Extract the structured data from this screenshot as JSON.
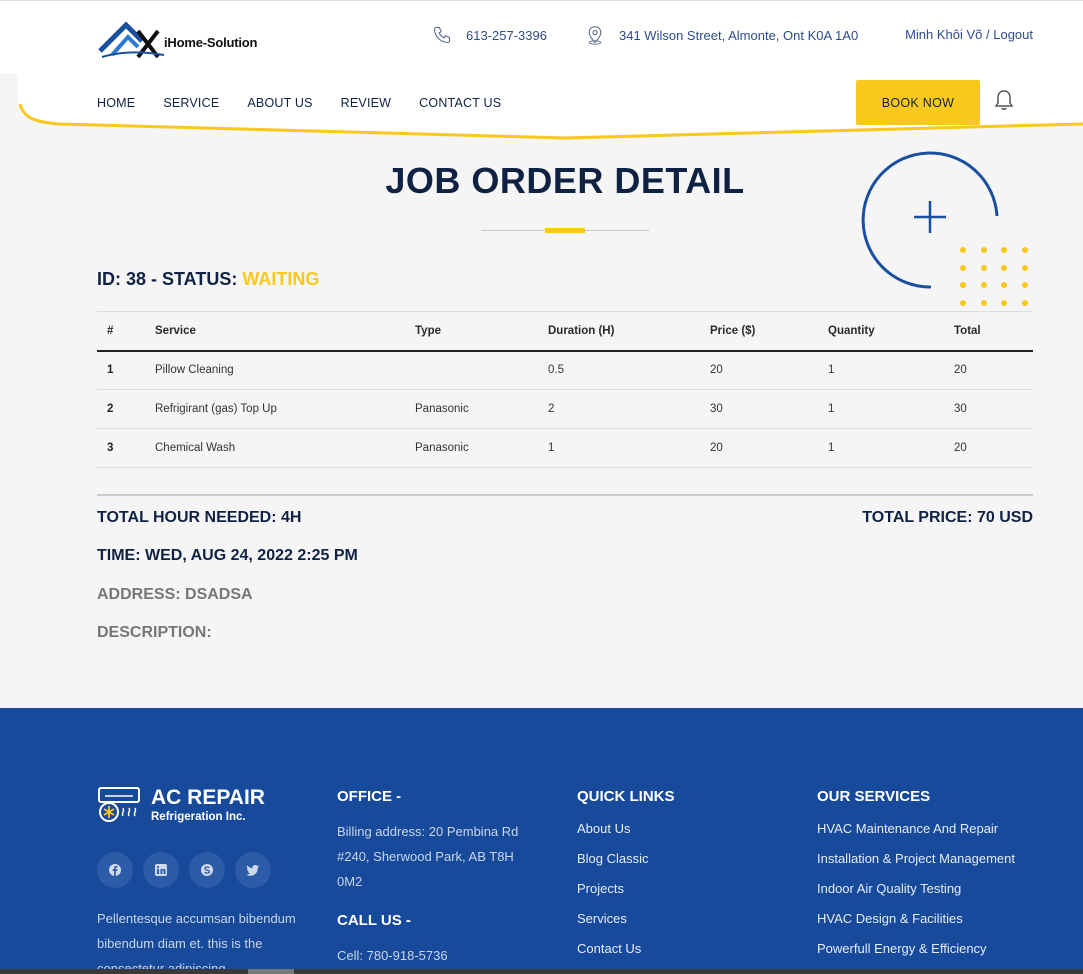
{
  "header": {
    "logo_text": "iHome-Solution",
    "phone": "613-257-3396",
    "address": "341 Wilson Street, Almonte, Ont K0A 1A0",
    "user": "Minh Khôi Võ / Logout"
  },
  "nav": {
    "items": [
      "HOME",
      "SERVICE",
      "ABOUT US",
      "REVIEW",
      "CONTACT US"
    ],
    "book_label": "BOOK NOW"
  },
  "page": {
    "title": "JOB ORDER DETAIL",
    "id_prefix": "ID: 38 - STATUS: ",
    "status": "WAITING"
  },
  "table": {
    "headers": [
      "#",
      "Service",
      "Type",
      "Duration (H)",
      "Price ($)",
      "Quantity",
      "Total"
    ],
    "rows": [
      [
        "1",
        "Pillow Cleaning",
        "",
        "0.5",
        "20",
        "1",
        "20"
      ],
      [
        "2",
        "Refrigirant (gas) Top Up",
        "Panasonic",
        "2",
        "30",
        "1",
        "30"
      ],
      [
        "3",
        "Chemical Wash",
        "Panasonic",
        "1",
        "20",
        "1",
        "20"
      ]
    ]
  },
  "summary": {
    "total_hour": "TOTAL HOUR NEEDED: 4H",
    "total_price": "TOTAL PRICE: 70 USD",
    "time": "TIME: WED, AUG 24, 2022 2:25 PM",
    "address": "ADDRESS: DSADSA",
    "description": "DESCRIPTION:"
  },
  "footer": {
    "brand_title": "AC REPAIR",
    "brand_sub": "Refrigeration Inc.",
    "about": "Pellentesque accumsan bibendum bibendum diam et. this is the consectetur adipiscing.",
    "office_head": "OFFICE -",
    "office_text": "Billing address: 20 Pembina Rd #240, Sherwood Park, AB T8H 0M2",
    "call_head": "CALL US -",
    "call_text": "Cell: 780-918-5736",
    "links_head": "QUICK LINKS",
    "links": [
      "About Us",
      "Blog Classic",
      "Projects",
      "Services",
      "Contact Us"
    ],
    "services_head": "OUR SERVICES",
    "services": [
      "HVAC Maintenance And Repair",
      "Installation & Project Management",
      "Indoor Air Quality Testing",
      "HVAC Design & Facilities",
      "Powerfull Energy & Efficiency"
    ],
    "social": [
      "facebook-icon",
      "linkedin-icon",
      "skype-icon",
      "twitter-icon"
    ]
  },
  "colors": {
    "accent": "#f9c81d",
    "navy": "#0f2244",
    "footer_blue": "#174a9b"
  }
}
